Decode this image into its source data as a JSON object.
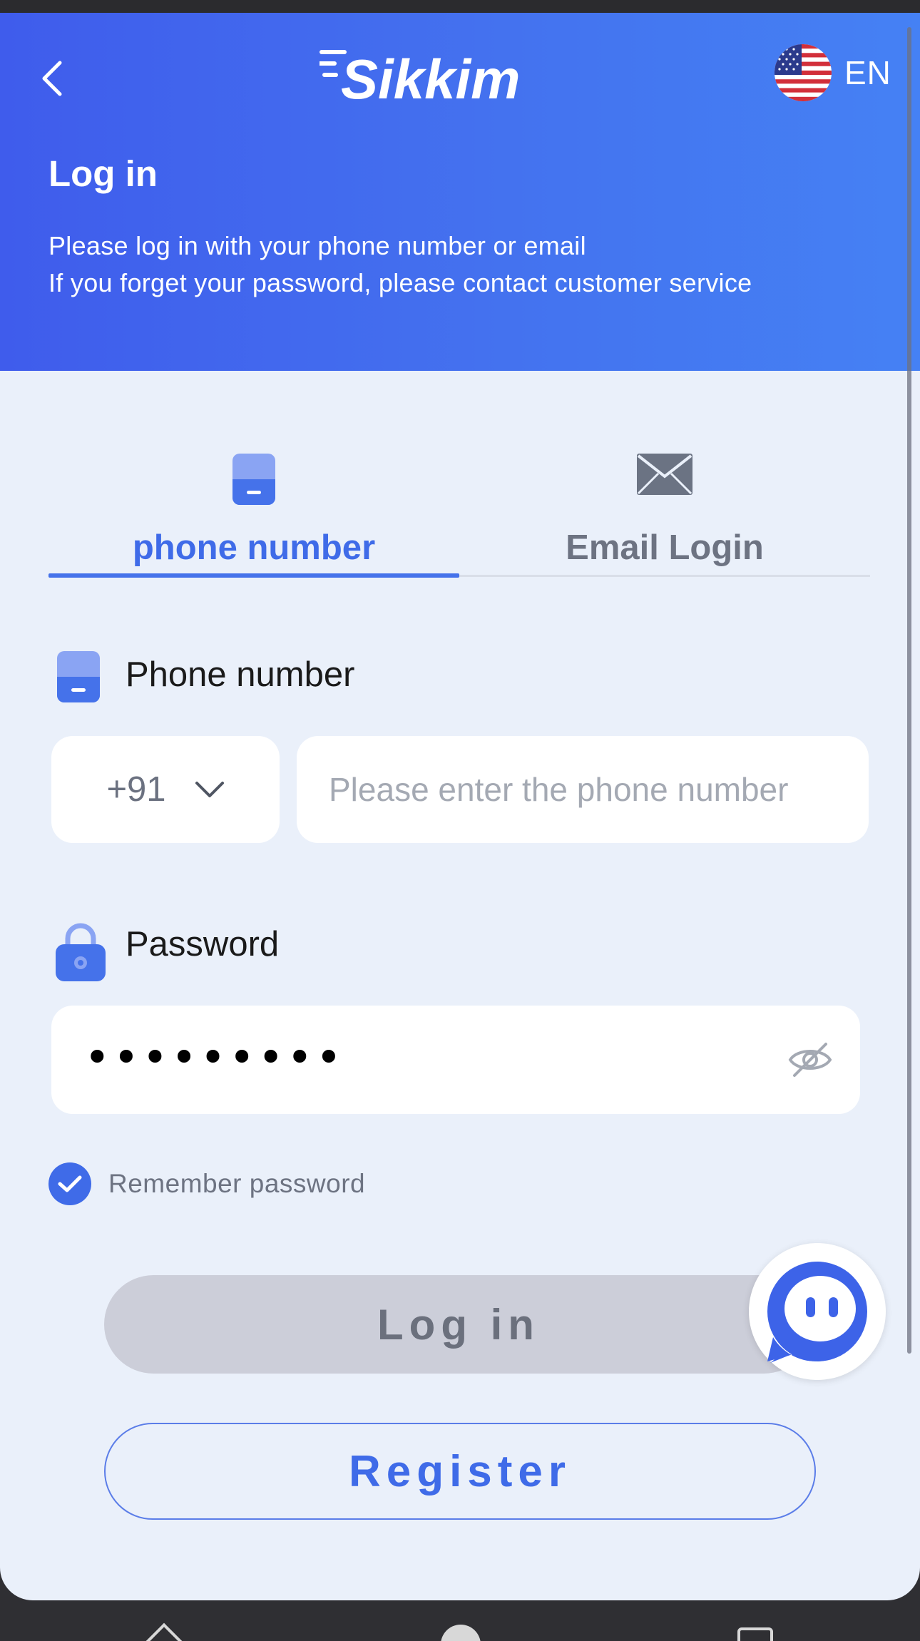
{
  "header": {
    "logo_text": "Sikkim",
    "language": "EN",
    "title": "Log in",
    "subtitle_lines": [
      "Please log in with your phone number or email",
      "If you forget your password, please contact customer service"
    ]
  },
  "tabs": [
    {
      "label": "phone number",
      "icon": "phone-icon",
      "active": true
    },
    {
      "label": "Email Login",
      "icon": "mail-icon",
      "active": false
    }
  ],
  "form": {
    "phone_label": "Phone number",
    "country_code": "+91",
    "phone_placeholder": "Please enter the phone number",
    "password_label": "Password",
    "password_masked": "•••••••••",
    "remember_label": "Remember password",
    "remember_checked": true
  },
  "buttons": {
    "login": "Log in",
    "register": "Register"
  },
  "colors": {
    "header_gradient_start": "#3f5cec",
    "header_gradient_end": "#4581f4",
    "accent": "#3f6be8",
    "disabled_button": "#ccced9"
  }
}
